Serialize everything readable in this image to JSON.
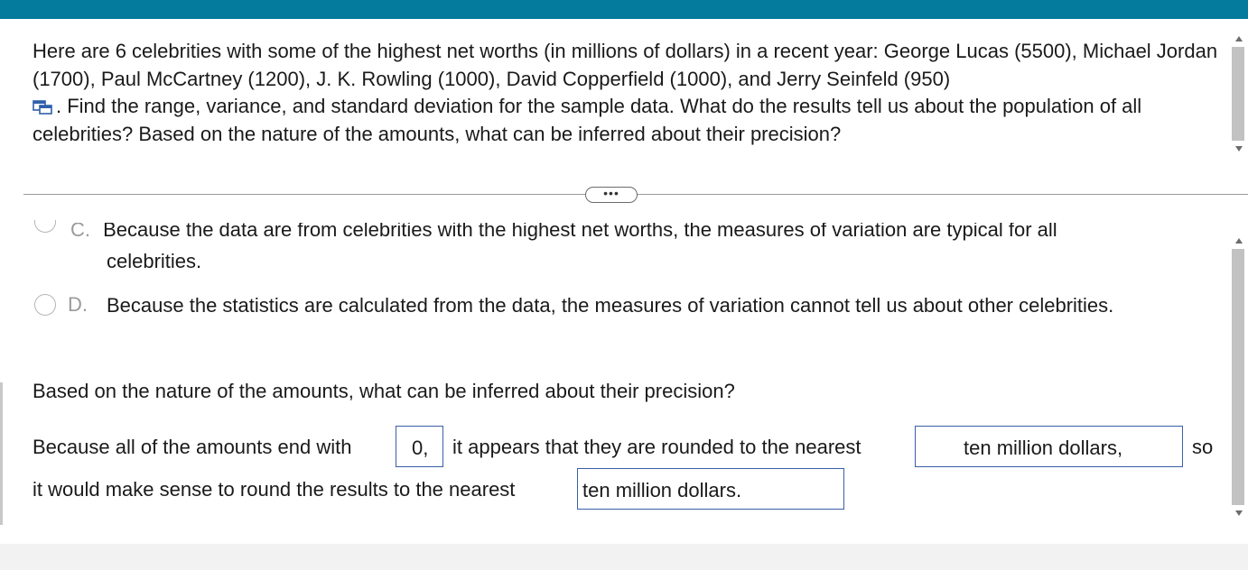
{
  "question": {
    "text_before_icon": "Here are 6 celebrities with some of the highest net worths (in millions of dollars) in a recent year: George Lucas (5500), Michael Jordan (1700), Paul McCartney (1200), J. K. Rowling (1000), David Copperfield (1000), and Jerry Seinfeld (950)",
    "text_after_icon": ". Find the range, variance, and standard deviation for the sample data. What do the results tell us about the population of all celebrities? Based on the nature of the amounts, what can be inferred about their precision?",
    "icon": "data-table-icon"
  },
  "expand_button": {
    "label": "•••"
  },
  "options": {
    "c": {
      "letter": "C.",
      "clipped_line": "Because the data are from celebrities with the highest net worths, the measures of variation are typical for all",
      "rest": "celebrities."
    },
    "d": {
      "letter": "D.",
      "text": "Because the statistics are calculated from the data, the measures of variation cannot tell us about other celebrities."
    }
  },
  "precision_question": "Based on the nature of the amounts, what can be inferred about their precision?",
  "answer": {
    "part1": "Because all of the amounts end with",
    "box1": "0,",
    "part2": "it appears that they are rounded to the nearest",
    "box2": "ten million dollars,",
    "part3": "so",
    "part4": "it would make sense to round the results to the nearest",
    "box3": "ten million dollars."
  },
  "colors": {
    "top_bar": "#047a9c",
    "answer_box_border": "#3a5fa8",
    "radio_border": "#b5b5b5"
  }
}
